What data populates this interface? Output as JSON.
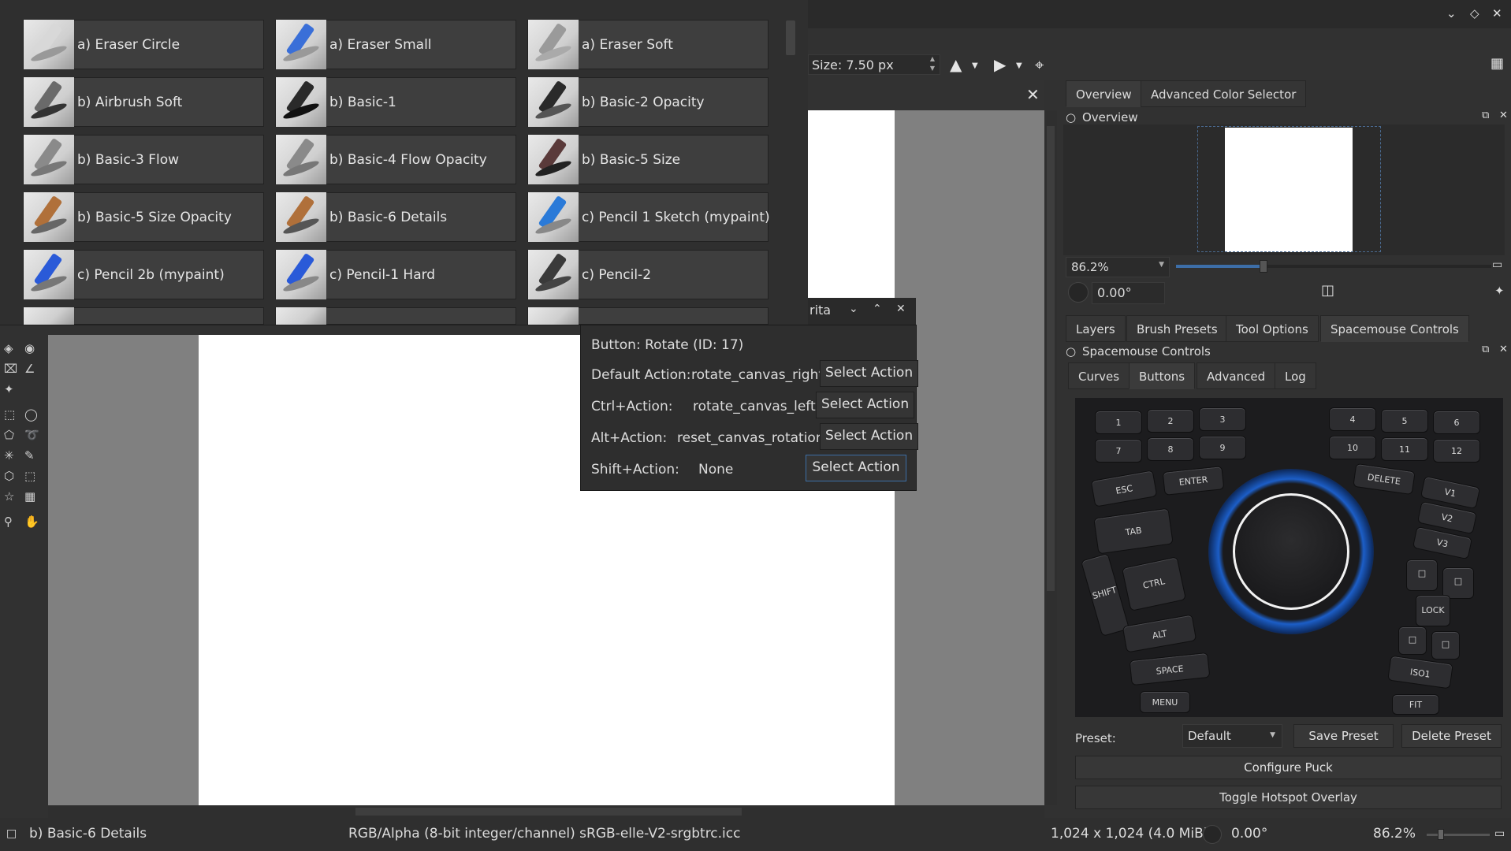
{
  "presets": [
    {
      "label": "a) Eraser Circle",
      "color": "#d8d8d8"
    },
    {
      "label": "a) Eraser Small",
      "color": "#3a6fd8"
    },
    {
      "label": "a) Eraser Soft",
      "color": "#9a9a9a"
    },
    {
      "label": "b) Airbrush Soft",
      "color": "#6a6a6a"
    },
    {
      "label": "b) Basic-1",
      "color": "#2a2a2a"
    },
    {
      "label": "b) Basic-2 Opacity",
      "color": "#2a2a2a"
    },
    {
      "label": "b) Basic-3 Flow",
      "color": "#8a8a8a"
    },
    {
      "label": "b) Basic-4 Flow Opacity",
      "color": "#8a8a8a"
    },
    {
      "label": "b) Basic-5 Size",
      "color": "#5a3a3a"
    },
    {
      "label": "b) Basic-5 Size Opacity",
      "color": "#b0703a"
    },
    {
      "label": "b) Basic-6 Details",
      "color": "#b0703a"
    },
    {
      "label": "c) Pencil 1 Sketch (mypaint)",
      "color": "#2a7ad8"
    },
    {
      "label": "c) Pencil 2b (mypaint)",
      "color": "#2a5ad8"
    },
    {
      "label": "c) Pencil-1 Hard",
      "color": "#2a5ad8"
    },
    {
      "label": "c) Pencil-2",
      "color": "#3a3a3a"
    }
  ],
  "toolbar": {
    "size_value": "Size: 7.50 px"
  },
  "popup": {
    "window_title": "rita",
    "button_title": "Button: Rotate (ID: 17)",
    "rows": [
      {
        "label": "Default Action:",
        "value": "rotate_canvas_right",
        "button": "Select Action"
      },
      {
        "label": "Ctrl+Action:",
        "value": "rotate_canvas_left",
        "button": "Select Action"
      },
      {
        "label": "Alt+Action:",
        "value": "reset_canvas_rotation",
        "button": "Select Action"
      },
      {
        "label": "Shift+Action:",
        "value": "None",
        "button": "Select Action"
      }
    ]
  },
  "dock_top": {
    "tabs": [
      "Overview",
      "Advanced Color Selector"
    ],
    "overview_title": "Overview",
    "zoom_value": "86.2%",
    "rotation_value": "0.00°"
  },
  "dock_bottom": {
    "tabs": [
      "Layers",
      "Brush Presets",
      "Tool Options",
      "Spacemouse Controls"
    ],
    "panel_title": "Spacemouse Controls",
    "subtabs": [
      "Curves",
      "Buttons",
      "Advanced",
      "Log"
    ],
    "preset_label": "Preset:",
    "preset_value": "Default",
    "save_preset": "Save Preset",
    "delete_preset": "Delete Preset",
    "configure_puck": "Configure Puck",
    "toggle_overlay": "Toggle Hotspot Overlay"
  },
  "spacemouse_keys": {
    "numbers": [
      "1",
      "2",
      "3",
      "4",
      "5",
      "6",
      "7",
      "8",
      "9",
      "10",
      "11",
      "12"
    ],
    "esc": "ESC",
    "enter": "ENTER",
    "delete": "DELETE",
    "tab": "TAB",
    "shift": "SHIFT",
    "ctrl": "CTRL",
    "alt": "ALT",
    "space": "SPACE",
    "menu": "MENU",
    "v1": "V1",
    "v2": "V2",
    "v3": "V3",
    "lock": "LOCK",
    "iso1": "ISO1",
    "fit": "FIT"
  },
  "statusbar": {
    "preset_name": "b) Basic-6 Details",
    "color_space": "RGB/Alpha (8-bit integer/channel)  sRGB-elle-V2-srgbtrc.icc",
    "image_size": "1,024 x 1,024 (4.0 MiB)",
    "rotation": "0.00°",
    "zoom": "86.2%"
  }
}
